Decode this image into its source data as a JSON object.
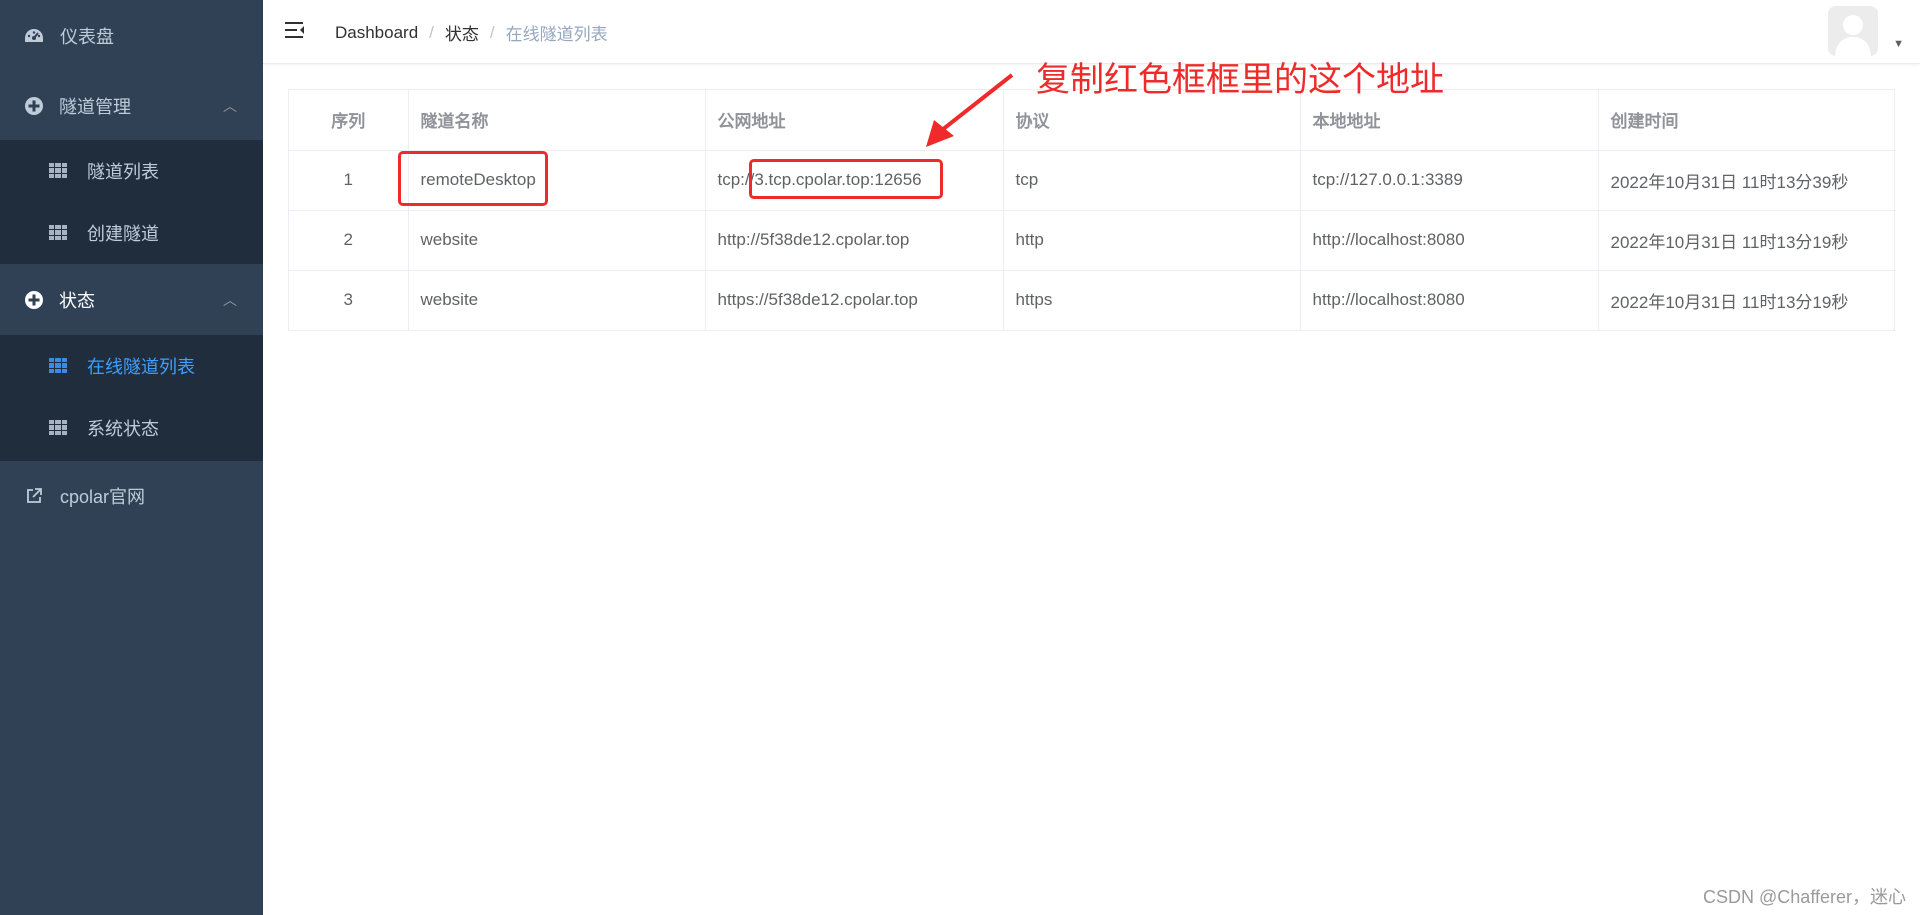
{
  "sidebar": {
    "items": [
      {
        "label": "仪表盘",
        "icon": "dashboard-icon"
      },
      {
        "label": "隧道管理",
        "icon": "circle-plus-icon",
        "expanded": true,
        "children": [
          {
            "label": "隧道列表",
            "icon": "table-icon"
          },
          {
            "label": "创建隧道",
            "icon": "table-icon"
          }
        ]
      },
      {
        "label": "状态",
        "icon": "circle-plus-icon",
        "expanded": true,
        "children": [
          {
            "label": "在线隧道列表",
            "icon": "table-icon",
            "active": true
          },
          {
            "label": "系统状态",
            "icon": "table-icon"
          }
        ]
      },
      {
        "label": "cpolar官网",
        "icon": "external-link-icon"
      }
    ]
  },
  "header": {
    "breadcrumb": [
      "Dashboard",
      "状态",
      "在线隧道列表"
    ],
    "separator": "/"
  },
  "table": {
    "columns": [
      "序列",
      "隧道名称",
      "公网地址",
      "协议",
      "本地地址",
      "创建时间"
    ],
    "rows": [
      [
        "1",
        "remoteDesktop",
        "tcp://3.tcp.cpolar.top:12656",
        "tcp",
        "tcp://127.0.0.1:3389",
        "2022年10月31日 11时13分39秒"
      ],
      [
        "2",
        "website",
        "http://5f38de12.cpolar.top",
        "http",
        "http://localhost:8080",
        "2022年10月31日 11时13分19秒"
      ],
      [
        "3",
        "website",
        "https://5f38de12.cpolar.top",
        "https",
        "http://localhost:8080",
        "2022年10月31日 11时13分19秒"
      ]
    ]
  },
  "annotation": {
    "text": "复制红色框框里的这个地址",
    "color": "#ee2a2a"
  },
  "watermark": "CSDN @Chafferer，迷心",
  "colors": {
    "sidebar_bg": "#304156",
    "submenu_bg": "#1f2d3d",
    "active": "#409eff"
  }
}
